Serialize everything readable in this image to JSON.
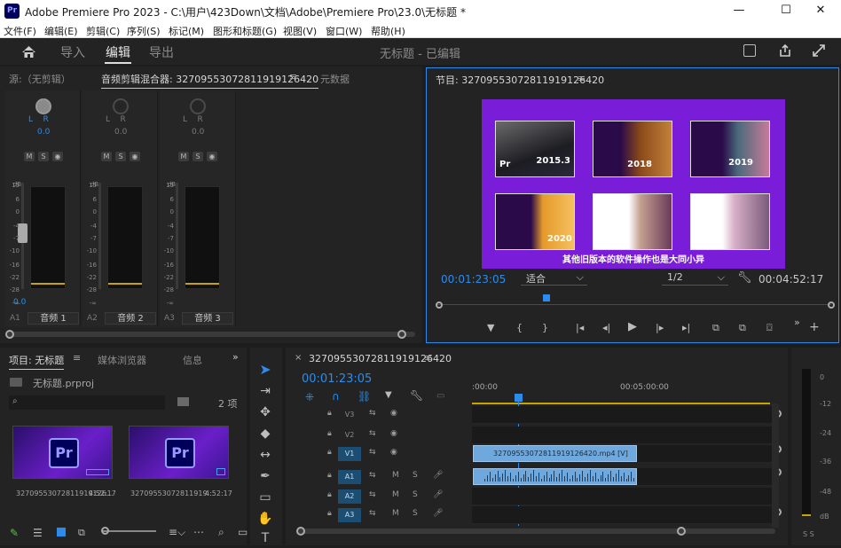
{
  "window": {
    "app_icon": "Pr",
    "title": "Adobe Premiere Pro 2023 - C:\\用户\\423Down\\文档\\Adobe\\Premiere Pro\\23.0\\无标题 *",
    "minimize": "—",
    "maximize": "☐",
    "close": "✕"
  },
  "menu": [
    "文件(F)",
    "编辑(E)",
    "剪辑(C)",
    "序列(S)",
    "标记(M)",
    "图形和标题(G)",
    "视图(V)",
    "窗口(W)",
    "帮助(H)"
  ],
  "workspace": {
    "tabs": [
      "导入",
      "编辑",
      "导出"
    ],
    "active": "编辑",
    "status": "无标题 - 已编辑"
  },
  "source_panel": {
    "tabs": [
      "源:（无剪辑）",
      "音频剪辑混合器: 3270955307281191912642​0",
      "元数据"
    ],
    "tab_source": "源:（无剪辑）",
    "tab_mixer": "音频剪辑混合器: 32709553072811919126420",
    "tab_meta": "元数据",
    "db_label": "dB",
    "lr_label": "L",
    "lr_r": "R",
    "scale": [
      "15",
      "6",
      "0",
      "-4",
      "-7",
      "-10",
      "-16",
      "-22",
      "-28",
      "-∞"
    ],
    "channels": [
      {
        "track": "A1",
        "name": "音频 1",
        "value": "0.0",
        "fader_value": "0.0",
        "active": true
      },
      {
        "track": "A2",
        "name": "音频 2",
        "value": "0.0",
        "active": false
      },
      {
        "track": "A3",
        "name": "音频 3",
        "value": "0.0",
        "active": false
      }
    ],
    "m": "M",
    "s": "S"
  },
  "program": {
    "title": "节目: 32709553072811919126420",
    "timecode": "00:01:23:05",
    "fit": "适合",
    "resolution": "1/2",
    "duration": "00:04:52:17",
    "caption": "其他旧版本的软件操作也是大同小异",
    "cards": [
      "2015.3",
      "2018",
      "2019",
      "2020",
      "",
      ""
    ]
  },
  "project": {
    "tabs": [
      "项目: 无标题",
      "媒体浏览器",
      "信息"
    ],
    "file": "无标题.prproj",
    "count": "2 项",
    "search_placeholder": "",
    "items": [
      {
        "name": "32709553072811919126...",
        "duration": "4:52:17"
      },
      {
        "name": "32709553072811919...",
        "duration": "4:52:17"
      }
    ]
  },
  "timeline": {
    "tab": "32709553072811919126420",
    "timecode": "00:01:23:05",
    "ruler": [
      ":00:00",
      "00:05:00:00"
    ],
    "video_tracks": [
      "V3",
      "V2",
      "V1"
    ],
    "audio_tracks": [
      "A1",
      "A2",
      "A3"
    ],
    "clip_label": "32709553072811919126420.mp4 [V]",
    "m": "M",
    "s": "S"
  },
  "meter": {
    "labels": [
      "0",
      "-12",
      "-24",
      "-36",
      "-48",
      "dB"
    ],
    "ss": "S S"
  },
  "colors": {
    "accent": "#2d8ceb",
    "clip": "#6fa8dc",
    "playhead": "#2d8ceb",
    "program_bg": "#7a1dd9"
  }
}
